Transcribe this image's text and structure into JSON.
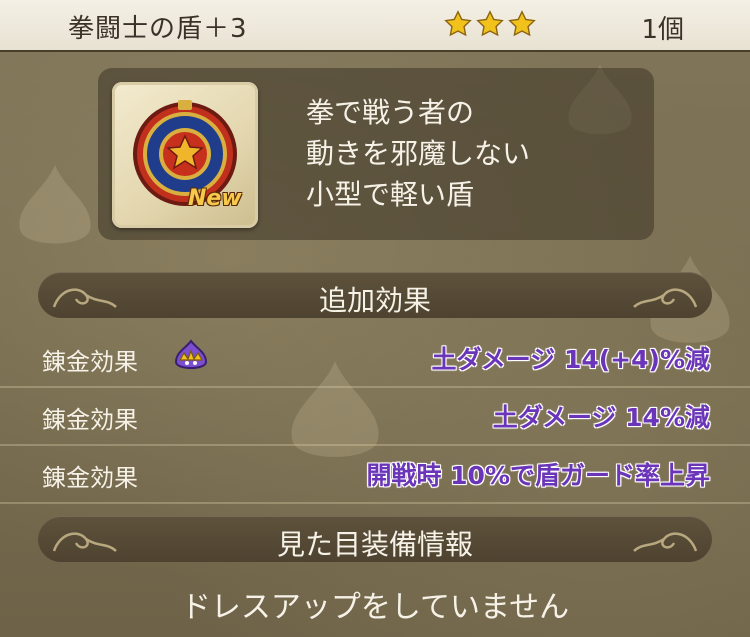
{
  "header": {
    "item_name": "拳闘士の盾＋3",
    "star_count": 3,
    "quantity": "1個"
  },
  "item": {
    "badge": "New",
    "description_lines": [
      "拳で戦う者の",
      "動きを邪魔しない",
      "小型で軽い盾"
    ]
  },
  "sections": {
    "extra_effects": "追加効果",
    "appearance": "見た目装備情報"
  },
  "effects": [
    {
      "name": "錬金効果",
      "value": "土ダメージ 14(+4)%減",
      "has_icon": true
    },
    {
      "name": "錬金効果",
      "value": "土ダメージ 14%減",
      "has_icon": false
    },
    {
      "name": "錬金効果",
      "value": "開戦時 10%で盾ガード率上昇",
      "has_icon": false
    }
  ],
  "appearance_message": "ドレスアップをしていません",
  "colors": {
    "effect_text": "#6a35b8",
    "star": "#f2c21c",
    "header_bg": "#f0ebdd"
  }
}
